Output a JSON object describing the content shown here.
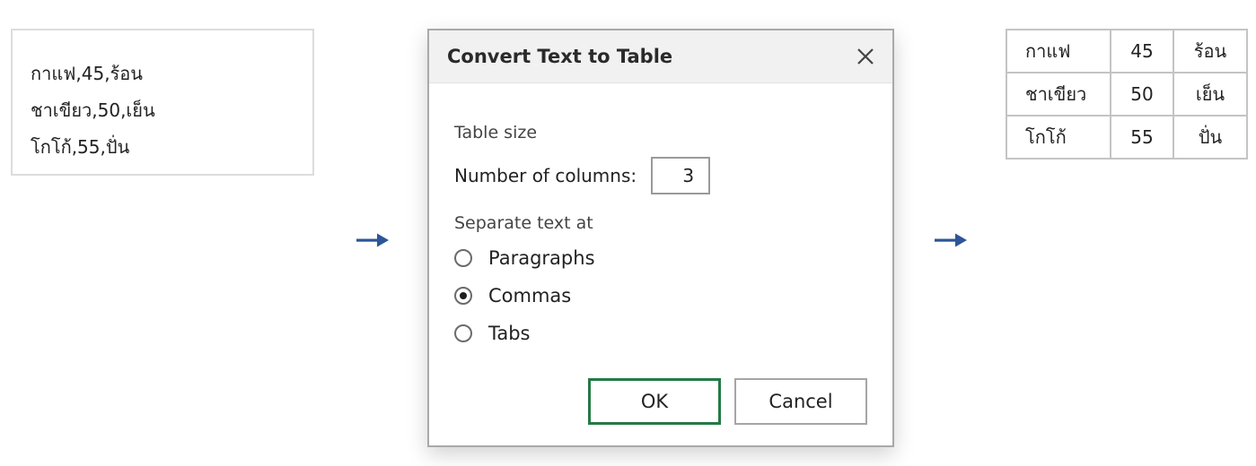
{
  "source": {
    "lines": [
      "กาแฟ,45,ร้อน",
      "ชาเขียว,50,เย็น",
      "โกโก้,55,ปั่น"
    ]
  },
  "dialog": {
    "title": "Convert Text to Table",
    "table_size_label": "Table size",
    "columns_label": "Number of columns:",
    "columns_value": "3",
    "separate_label": "Separate text at",
    "options": [
      {
        "label": "Paragraphs",
        "checked": false
      },
      {
        "label": "Commas",
        "checked": true
      },
      {
        "label": "Tabs",
        "checked": false
      }
    ],
    "ok_label": "OK",
    "cancel_label": "Cancel"
  },
  "result_table": {
    "rows": [
      [
        "กาแฟ",
        "45",
        "ร้อน"
      ],
      [
        "ชาเขียว",
        "50",
        "เย็น"
      ],
      [
        "โกโก้",
        "55",
        "ปั่น"
      ]
    ]
  },
  "colors": {
    "arrow": "#2d5597",
    "ok_border": "#247a46",
    "titlebar": "#f2f1f1"
  },
  "icons": {
    "arrow": "right-arrow-icon",
    "close": "close-icon"
  }
}
